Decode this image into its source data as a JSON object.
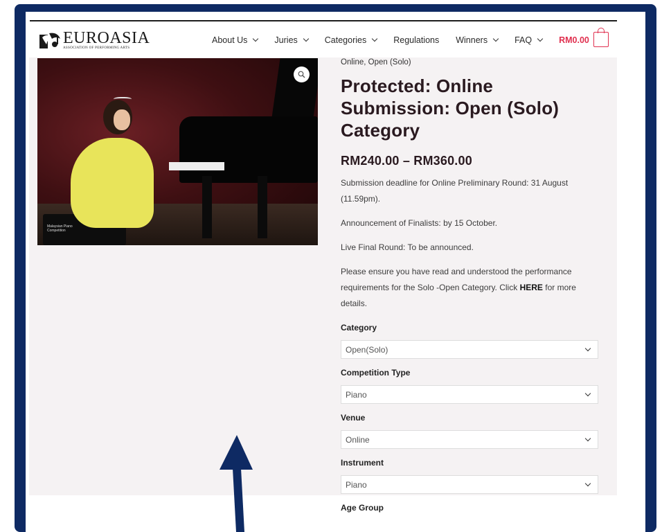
{
  "brand": {
    "name": "EUROASIA",
    "tagline": "ASSOCIATION OF PERFORMING ARTS"
  },
  "nav": {
    "items": [
      {
        "label": "About Us",
        "has_dropdown": true
      },
      {
        "label": "Juries",
        "has_dropdown": true
      },
      {
        "label": "Categories",
        "has_dropdown": true
      },
      {
        "label": "Regulations",
        "has_dropdown": false
      },
      {
        "label": "Winners",
        "has_dropdown": true
      },
      {
        "label": "FAQ",
        "has_dropdown": true
      }
    ],
    "cart_total": "RM0.00"
  },
  "product": {
    "image_watermark": "Malaysian Piano Competition",
    "posted_in": "Online, Open (Solo)",
    "title": "Protected: Online Submission: Open (Solo) Category",
    "price_range": "RM240.00 – RM360.00",
    "description": {
      "deadline": "Submission deadline for Online Preliminary Round: 31 August (11.59pm).",
      "finalists": "Announcement of Finalists: by 15 October.",
      "final_round": "Live Final Round: To be announced.",
      "note_prefix": "Please ensure you have read and understood the performance requirements for the Solo -Open Category. Click ",
      "note_link": "HERE",
      "note_suffix": " for more details."
    },
    "variations": [
      {
        "label": "Category",
        "value": "Open(Solo)"
      },
      {
        "label": "Competition Type",
        "value": "Piano"
      },
      {
        "label": "Venue",
        "value": "Online"
      },
      {
        "label": "Instrument",
        "value": "Piano"
      }
    ],
    "next_label": "Age Group"
  },
  "colors": {
    "frame": "#0e2a63",
    "accent": "#e0304f",
    "content_bg": "#f5f2f3"
  },
  "icons": {
    "zoom": "magnifier-icon",
    "cart": "shopping-bag-icon",
    "dropdown": "chevron-down-icon",
    "annotation": "up-arrow"
  }
}
